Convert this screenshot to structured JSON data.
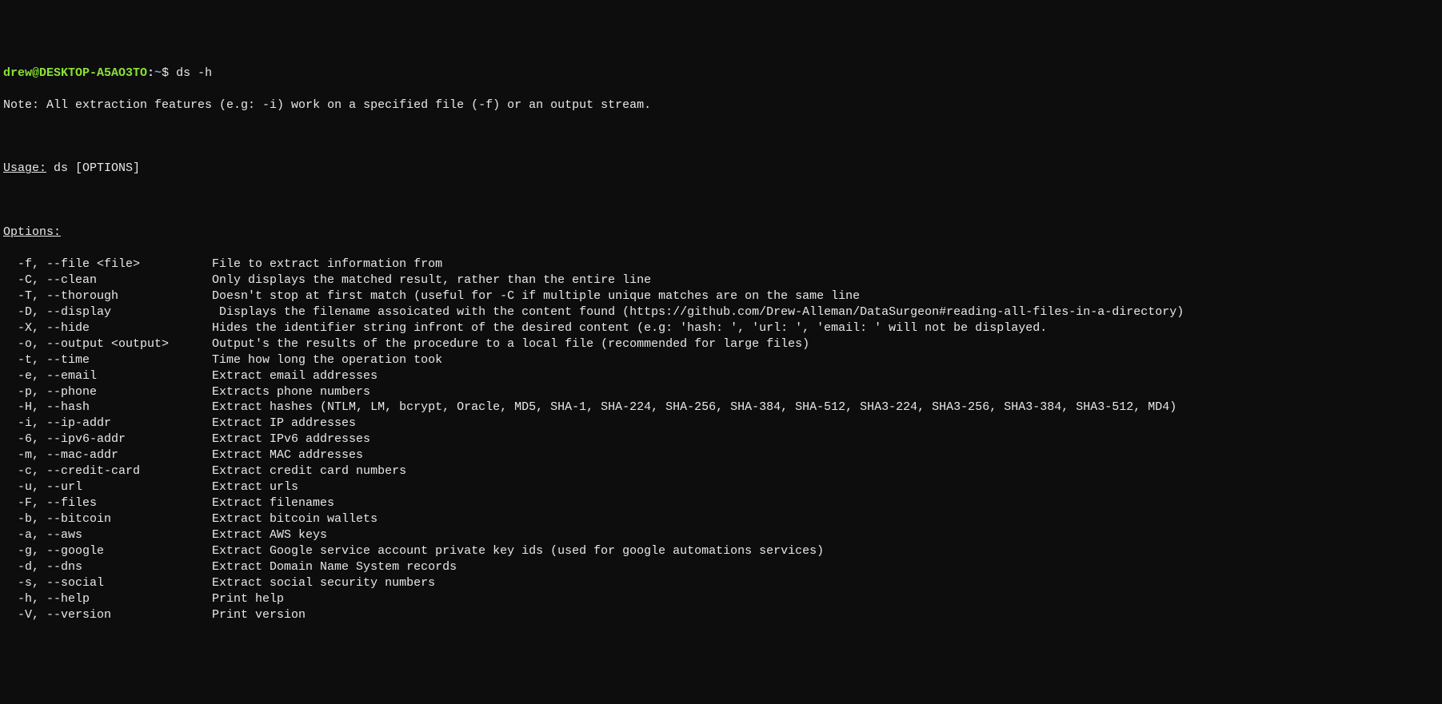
{
  "prompt": {
    "user_host": "drew@DESKTOP-A5AO3TO",
    "sep": ":",
    "path": "~",
    "dollar": "$",
    "command": "ds -h"
  },
  "note": "Note: All extraction features (e.g: -i) work on a specified file (-f) or an output stream.",
  "usage_label": "Usage:",
  "usage_text": " ds [OPTIONS]",
  "options_label": "Options:",
  "options": [
    {
      "flag": "-f, --file <file>",
      "desc": "File to extract information from"
    },
    {
      "flag": "-C, --clean",
      "desc": "Only displays the matched result, rather than the entire line"
    },
    {
      "flag": "-T, --thorough",
      "desc": "Doesn't stop at first match (useful for -C if multiple unique matches are on the same line"
    },
    {
      "flag": "-D, --display",
      "desc": " Displays the filename assoicated with the content found (https://github.com/Drew-Alleman/DataSurgeon#reading-all-files-in-a-directory)"
    },
    {
      "flag": "-X, --hide",
      "desc": "Hides the identifier string infront of the desired content (e.g: 'hash: ', 'url: ', 'email: ' will not be displayed."
    },
    {
      "flag": "-o, --output <output>",
      "desc": "Output's the results of the procedure to a local file (recommended for large files)"
    },
    {
      "flag": "-t, --time",
      "desc": "Time how long the operation took"
    },
    {
      "flag": "-e, --email",
      "desc": "Extract email addresses"
    },
    {
      "flag": "-p, --phone",
      "desc": "Extracts phone numbers"
    },
    {
      "flag": "-H, --hash",
      "desc": "Extract hashes (NTLM, LM, bcrypt, Oracle, MD5, SHA-1, SHA-224, SHA-256, SHA-384, SHA-512, SHA3-224, SHA3-256, SHA3-384, SHA3-512, MD4)"
    },
    {
      "flag": "-i, --ip-addr",
      "desc": "Extract IP addresses"
    },
    {
      "flag": "-6, --ipv6-addr",
      "desc": "Extract IPv6 addresses"
    },
    {
      "flag": "-m, --mac-addr",
      "desc": "Extract MAC addresses"
    },
    {
      "flag": "-c, --credit-card",
      "desc": "Extract credit card numbers"
    },
    {
      "flag": "-u, --url",
      "desc": "Extract urls"
    },
    {
      "flag": "-F, --files",
      "desc": "Extract filenames"
    },
    {
      "flag": "-b, --bitcoin",
      "desc": "Extract bitcoin wallets"
    },
    {
      "flag": "-a, --aws",
      "desc": "Extract AWS keys"
    },
    {
      "flag": "-g, --google",
      "desc": "Extract Google service account private key ids (used for google automations services)"
    },
    {
      "flag": "-d, --dns",
      "desc": "Extract Domain Name System records"
    },
    {
      "flag": "-s, --social",
      "desc": "Extract social security numbers"
    },
    {
      "flag": "-h, --help",
      "desc": "Print help"
    },
    {
      "flag": "-V, --version",
      "desc": "Print version"
    }
  ]
}
